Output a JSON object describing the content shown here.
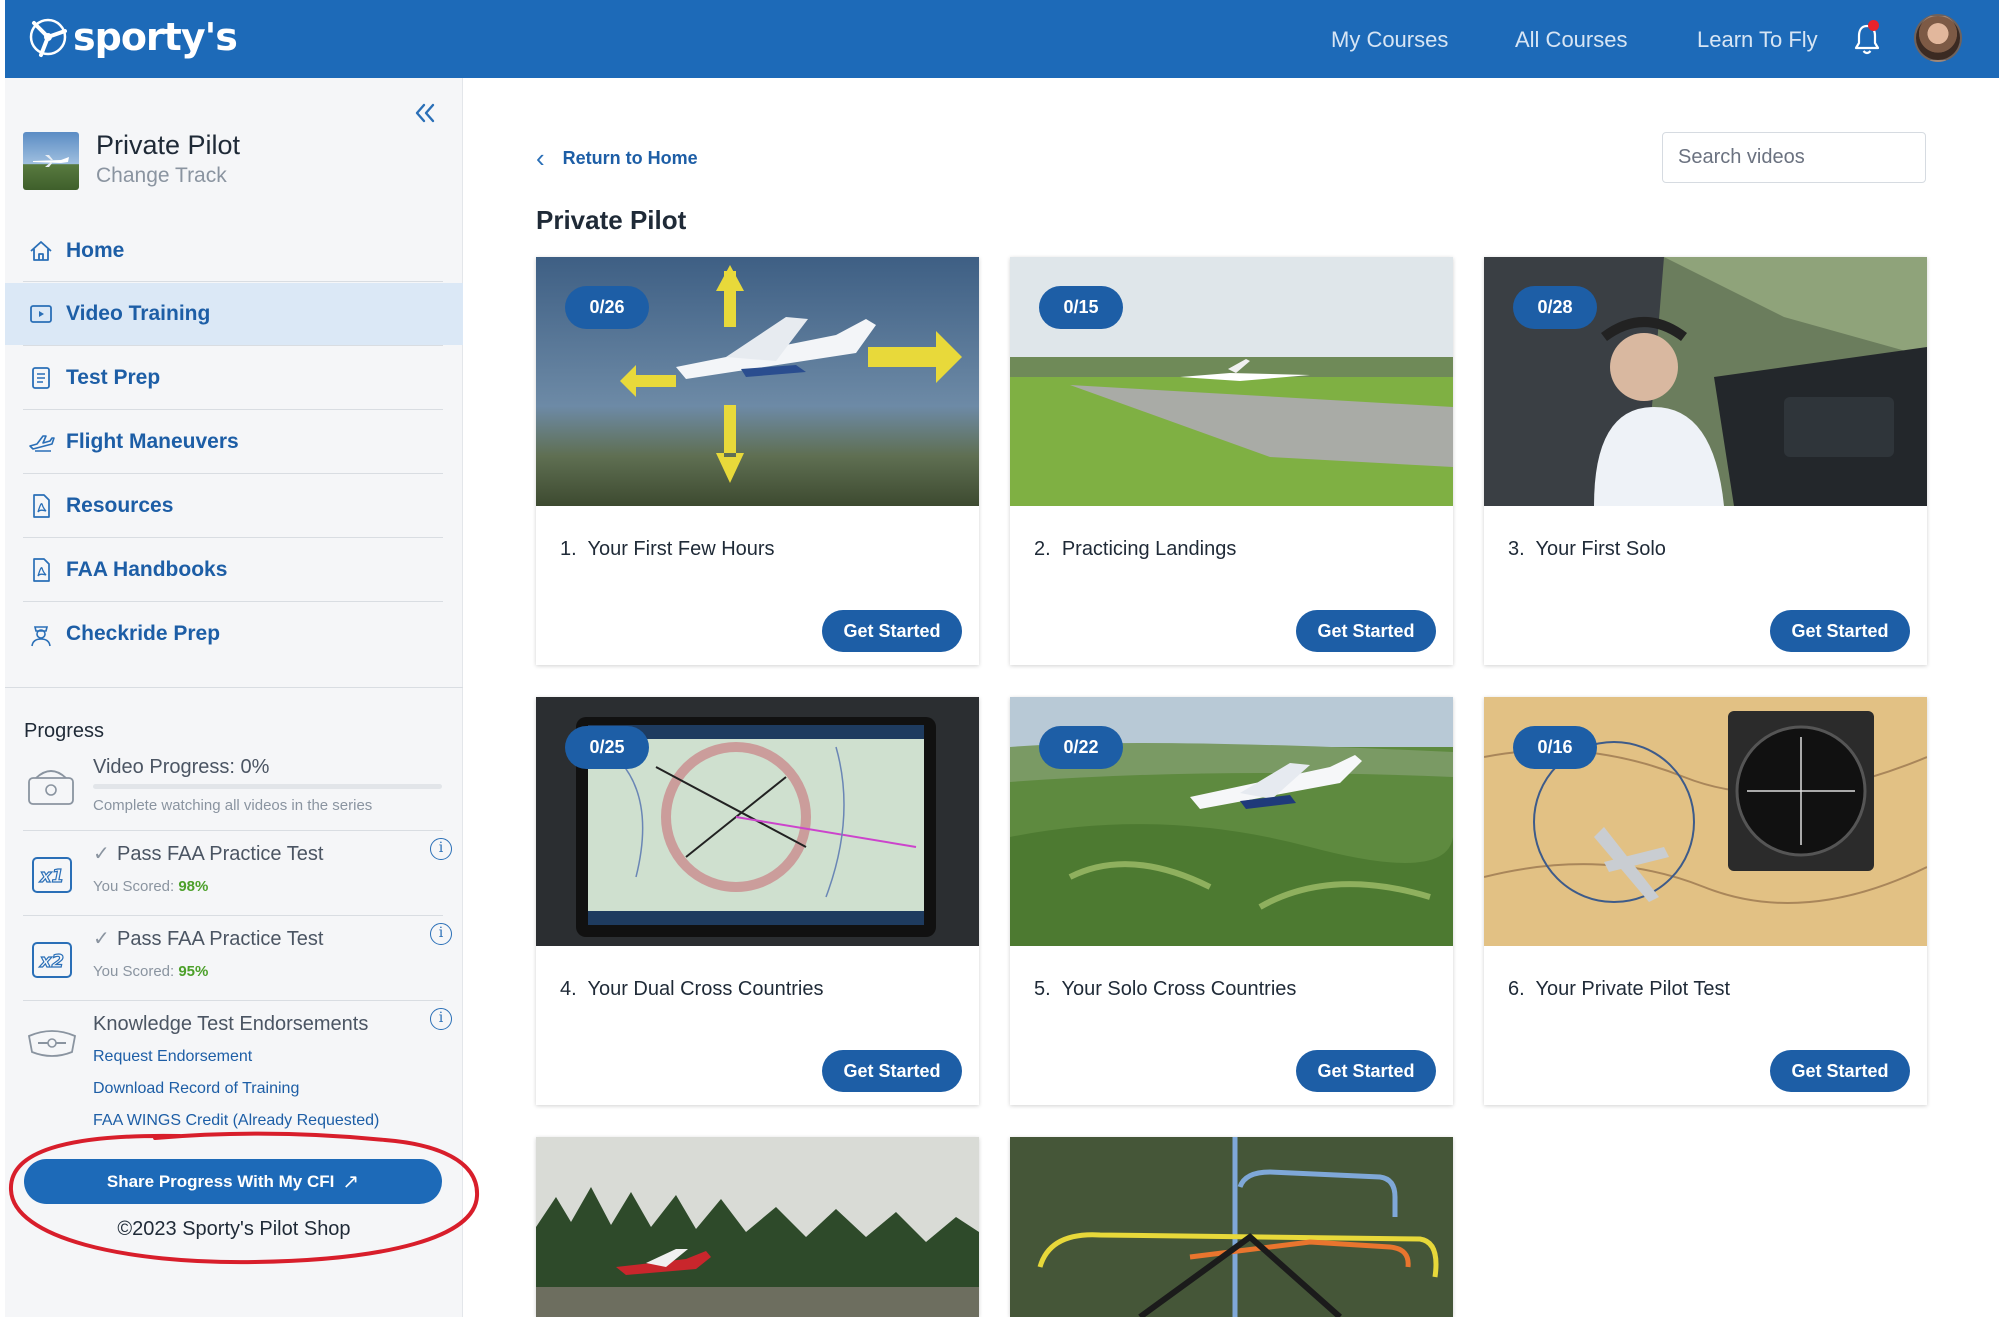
{
  "header": {
    "logo_text": "sporty's",
    "nav": [
      "My Courses",
      "All Courses",
      "Learn To Fly"
    ]
  },
  "sidebar": {
    "track_title": "Private Pilot",
    "track_subtitle": "Change Track",
    "items": [
      {
        "label": "Home",
        "icon": "home-icon"
      },
      {
        "label": "Video Training",
        "icon": "video-icon",
        "active": true
      },
      {
        "label": "Test Prep",
        "icon": "document-icon"
      },
      {
        "label": "Flight Maneuvers",
        "icon": "airplane-icon"
      },
      {
        "label": "Resources",
        "icon": "pdf-icon"
      },
      {
        "label": "FAA Handbooks",
        "icon": "pdf-icon"
      },
      {
        "label": "Checkride Prep",
        "icon": "examiner-icon"
      }
    ],
    "progress": {
      "heading": "Progress",
      "video_progress_label": "Video Progress: 0%",
      "video_progress_value": 0,
      "video_progress_note": "Complete watching all videos in the series",
      "tests": [
        {
          "label": "Pass FAA Practice Test",
          "score_prefix": "You Scored: ",
          "score": "98%",
          "icon_text": "x1"
        },
        {
          "label": "Pass FAA Practice Test",
          "score_prefix": "You Scored: ",
          "score": "95%",
          "icon_text": "x2"
        }
      ],
      "endorsements_label": "Knowledge Test Endorsements",
      "links": [
        "Request Endorsement",
        "Download Record of Training",
        "FAA WINGS Credit (Already Requested)"
      ]
    },
    "share_button": "Share Progress With My CFI",
    "share_arrow": "↗",
    "copyright": "©2023 Sporty's Pilot Shop"
  },
  "main": {
    "back_link": "Return to Home",
    "search_placeholder": "Search videos",
    "page_title": "Private Pilot",
    "cards": [
      {
        "badge": "0/26",
        "number": "1.",
        "title": "Your First Few Hours",
        "button": "Get Started"
      },
      {
        "badge": "0/15",
        "number": "2.",
        "title": "Practicing Landings",
        "button": "Get Started"
      },
      {
        "badge": "0/28",
        "number": "3.",
        "title": "Your First Solo",
        "button": "Get Started"
      },
      {
        "badge": "0/25",
        "number": "4.",
        "title": "Your Dual Cross Countries",
        "button": "Get Started"
      },
      {
        "badge": "0/22",
        "number": "5.",
        "title": "Your Solo Cross Countries",
        "button": "Get Started"
      },
      {
        "badge": "0/16",
        "number": "6.",
        "title": "Your Private Pilot Test",
        "button": "Get Started"
      }
    ]
  },
  "colors": {
    "brand_blue": "#1d6ab8",
    "accent_blue": "#1d5ea6",
    "score_green": "#4ca02a",
    "annotation_red": "#d81e2b"
  }
}
